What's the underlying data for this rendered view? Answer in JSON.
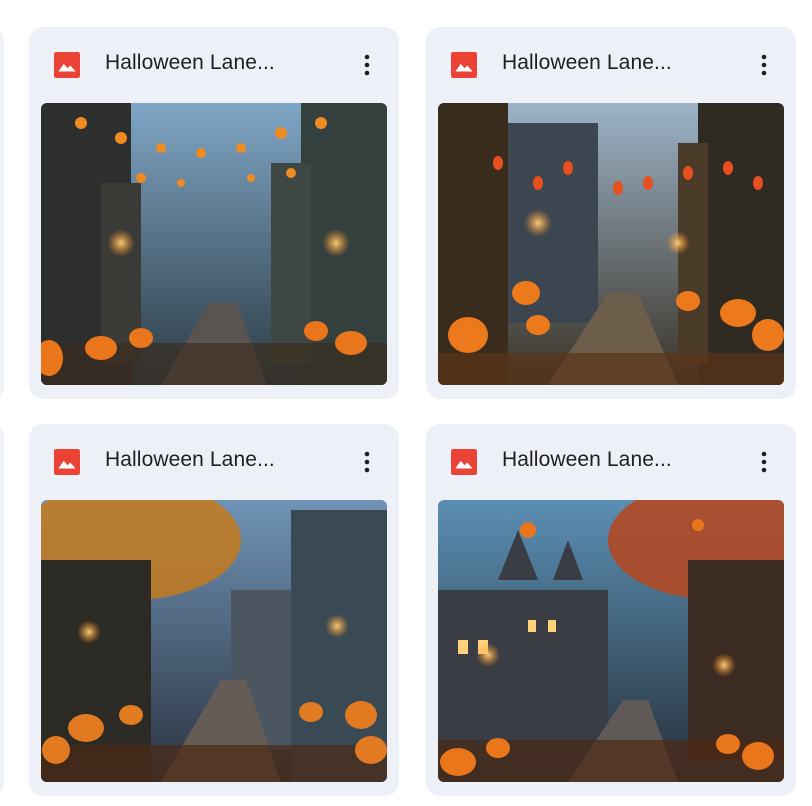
{
  "files": [
    {
      "title": "Halloween Lane...",
      "type_icon": "image-file-icon",
      "menu_icon": "more-vert-icon"
    },
    {
      "title": "Halloween Lane...",
      "type_icon": "image-file-icon",
      "menu_icon": "more-vert-icon"
    },
    {
      "title": "Halloween Lane...",
      "type_icon": "image-file-icon",
      "menu_icon": "more-vert-icon"
    },
    {
      "title": "Halloween Lane...",
      "type_icon": "image-file-icon",
      "menu_icon": "more-vert-icon"
    }
  ],
  "colors": {
    "card_background": "#edf1f7",
    "file_icon_red": "#ea4335",
    "title_text": "#1f1f1f"
  }
}
